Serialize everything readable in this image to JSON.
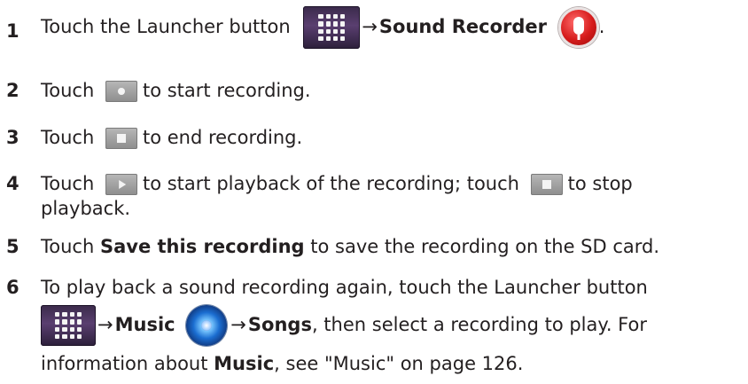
{
  "steps": [
    {
      "number": "1",
      "text_before": "Touch the Launcher button",
      "arrow": "→",
      "bold_after": "Sound Recorder",
      "trailing": "."
    },
    {
      "number": "2",
      "before": "Touch",
      "after": "to start recording."
    },
    {
      "number": "3",
      "before": "Touch",
      "after": "to end recording."
    },
    {
      "number": "4",
      "before": "Touch",
      "middle": "to start playback of the recording; touch",
      "after": "to stop",
      "continuation": "playback."
    },
    {
      "number": "5",
      "before": "Touch",
      "bold": "Save this recording",
      "after": "to save the recording on the SD card."
    },
    {
      "number": "6",
      "line1": "To play back a sound recording again, touch the Launcher button",
      "arrow1": "→",
      "music_bold": "Music",
      "arrow2": "→",
      "songs_bold": "Songs",
      "line2_tail": ", then select a recording to play. For",
      "line3_before": "information about",
      "line3_bold": "Music",
      "line3_after": ", see \"Music\" on page 126."
    }
  ],
  "icons": {
    "launcher": "launcher-grid-icon",
    "recorder": "microphone-icon",
    "music": "speaker-disc-icon",
    "record": "record-button-icon",
    "stop": "stop-button-icon",
    "play": "play-button-icon"
  },
  "colors": {
    "text": "#231f20",
    "launcher_bg": "#4a3460",
    "recorder_red": "#d61c1c",
    "music_blue": "#1b6ed1",
    "control_gray": "#a0a0a0"
  }
}
